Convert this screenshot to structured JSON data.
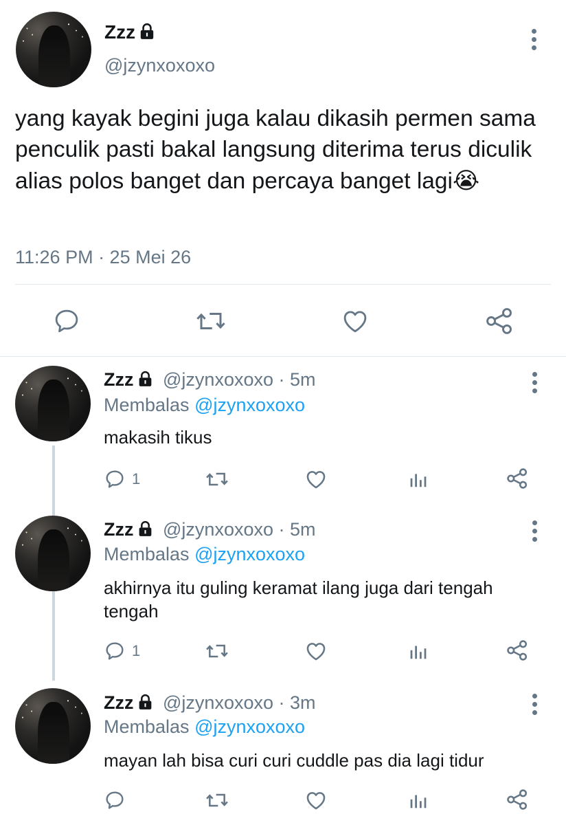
{
  "main_tweet": {
    "display_name": "Zzz",
    "handle": "@jzynxoxoxo",
    "text": "yang kayak begini juga kalau dikasih permen sama penculik pasti bakal langsung diterima terus diculik alias polos banget dan percaya banget lagi",
    "emoji": "😭",
    "timestamp": "11:26 PM · 25 Mei 26"
  },
  "replies": [
    {
      "display_name": "Zzz",
      "handle_time": "@jzynxoxoxo · 5m",
      "replying_prefix": "Membalas",
      "replying_to": "@jzynxoxoxo",
      "text": "makasih tikus",
      "reply_count": "1"
    },
    {
      "display_name": "Zzz",
      "handle_time": "@jzynxoxoxo · 5m",
      "replying_prefix": "Membalas",
      "replying_to": "@jzynxoxoxo",
      "text": "akhirnya itu guling keramat ilang juga dari tengah tengah",
      "reply_count": "1"
    },
    {
      "display_name": "Zzz",
      "handle_time": "@jzynxoxoxo · 3m",
      "replying_prefix": "Membalas",
      "replying_to": "@jzynxoxoxo",
      "text": "mayan lah bisa curi curi cuddle pas dia lagi tidur",
      "reply_count": ""
    }
  ],
  "icons": {
    "reply": "reply-icon",
    "retweet": "retweet-icon",
    "like": "heart-icon",
    "analytics": "analytics-icon",
    "share": "share-icon",
    "more": "more-vertical-icon",
    "lock": "lock-icon"
  },
  "colors": {
    "text": "#14171a",
    "muted": "#657786",
    "link": "#1da1f2",
    "divider": "#e1e8ed",
    "thread_line": "#ccd6dd"
  }
}
